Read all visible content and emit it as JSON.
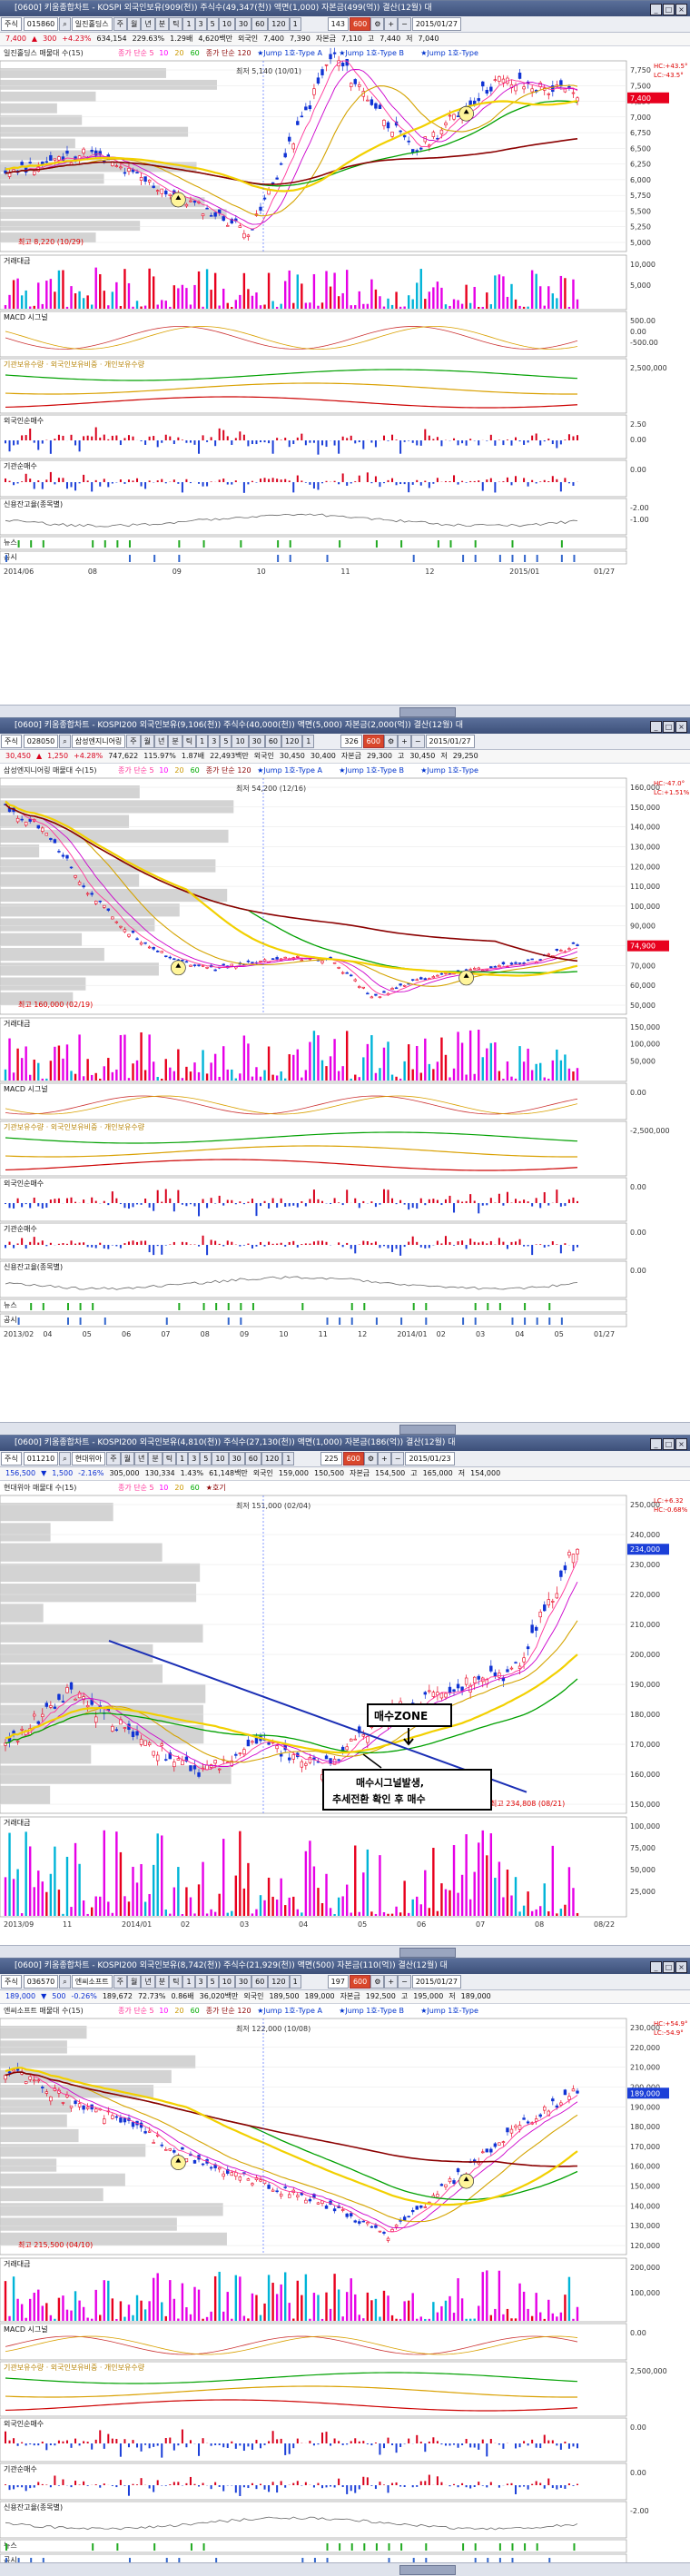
{
  "panels": [
    {
      "id": "p1",
      "title": "[0600] 키움종합차트 - KOSPI 외국인보유(909(천)) 주식수(49,347(천)) 액면(1,000) 자본금(499(억)) 결산(12월) 대",
      "code": "015860",
      "name": "일진홀딩스",
      "period_buttons": [
        "주",
        "월",
        "년",
        "분",
        "틱",
        "1",
        "3",
        "5",
        "10",
        "30",
        "60",
        "120",
        "1"
      ],
      "count": "143",
      "count2": "600",
      "date": "2015/01/27",
      "quote": [
        "7,400",
        "▲",
        "300",
        "+4.23%",
        "634,154",
        "229.63%",
        "1.29배",
        "4,620백만",
        "외국인",
        "7,400",
        "7,390",
        "자본금",
        "7,110",
        "고",
        "7,440",
        "저",
        "7,040"
      ],
      "legend_head": "일진홀딩스 매물대 수(15)",
      "legend_items": [
        "종가 단순 5",
        "10",
        "20",
        "60",
        "종가 단순 120",
        "★Jump 1호-Type A",
        "★Jump 1호-Type B",
        "★Jump 1호-Type"
      ],
      "axis_right": [
        "7,750",
        "7,500",
        "7,250",
        "7,000",
        "6,750",
        "6,500",
        "6,250",
        "6,000",
        "5,750",
        "5,500",
        "5,250",
        "5,000"
      ],
      "ann_high": "최저 5,140 (10/01)",
      "ann_low": "최고 8,220 (10/29)",
      "price_label": "7,400",
      "side_labels": [
        "HC:+43.5°",
        "LC:-43.5°"
      ],
      "sub": [
        {
          "label": "거래대금",
          "axis": [
            "10,000",
            "5,000"
          ]
        },
        {
          "label": "MACD 시그널",
          "axis": [
            "500.00",
            "0.00",
            "-500.00"
          ]
        },
        {
          "label": "기관보유수량 · 외국인보유비중 · 개인보유수량",
          "axis": [
            "2,500,000"
          ]
        },
        {
          "label": "외국인순매수",
          "axis": [
            "2.50",
            "0.00"
          ]
        },
        {
          "label": "기관순매수",
          "axis": [
            "0.00"
          ]
        },
        {
          "label": "신용잔고율(종목별)",
          "axis": [
            "-2.00",
            "-1.00"
          ]
        },
        {
          "label": "뉴스",
          "axis": []
        },
        {
          "label": "공시",
          "axis": []
        }
      ],
      "x_labels": [
        "2014/06",
        "08",
        "09",
        "10",
        "11",
        "12",
        "2015/01",
        "01/27"
      ]
    },
    {
      "id": "p2",
      "title": "[0600] 키움종합차트 - KOSPI200 외국인보유(9,106(천)) 주식수(40,000(천)) 액면(5,000) 자본금(2,000(억)) 결산(12월) 대",
      "code": "028050",
      "name": "삼성엔지니어링",
      "period_buttons": [
        "주",
        "월",
        "년",
        "분",
        "틱",
        "1",
        "3",
        "5",
        "10",
        "30",
        "60",
        "120",
        "1"
      ],
      "count": "326",
      "count2": "600",
      "date": "2015/01/27",
      "quote": [
        "30,450",
        "▲",
        "1,250",
        "+4.28%",
        "747,622",
        "115.97%",
        "1.87배",
        "22,493백만",
        "외국인",
        "30,450",
        "30,400",
        "자본금",
        "29,300",
        "고",
        "30,450",
        "저",
        "29,250"
      ],
      "legend_head": "삼성엔지니어링 매물대 수(15)",
      "legend_items": [
        "종가 단순 5",
        "10",
        "20",
        "60",
        "종가 단순 120",
        "★Jump 1호-Type A",
        "★Jump 1호-Type B",
        "★Jump 1호-Type"
      ],
      "axis_right": [
        "160,000",
        "150,000",
        "140,000",
        "130,000",
        "120,000",
        "110,000",
        "100,000",
        "90,000",
        "80,000",
        "70,000",
        "60,000",
        "50,000"
      ],
      "ann_high": "최저 54,200 (12/16)",
      "ann_low": "최고 160,000 (02/19)",
      "price_label": "74,900",
      "side_labels": [
        "HC:-47.0°",
        "LC:+1.51%"
      ],
      "sub": [
        {
          "label": "거래대금",
          "axis": [
            "150,000",
            "100,000",
            "50,000"
          ]
        },
        {
          "label": "MACD 시그널",
          "axis": [
            "0.00"
          ]
        },
        {
          "label": "기관보유수량 · 외국인보유비중 · 개인보유수량",
          "axis": [
            "-2,500,000"
          ]
        },
        {
          "label": "외국인순매수",
          "axis": [
            "0.00"
          ]
        },
        {
          "label": "기관순매수",
          "axis": [
            "0.00"
          ]
        },
        {
          "label": "신용잔고율(종목별)",
          "axis": [
            "0.00"
          ]
        },
        {
          "label": "뉴스",
          "axis": []
        },
        {
          "label": "공시",
          "axis": []
        }
      ],
      "x_labels": [
        "2013/02",
        "04",
        "05",
        "06",
        "07",
        "08",
        "09",
        "10",
        "11",
        "12",
        "2014/01",
        "02",
        "03",
        "04",
        "05",
        "01/27"
      ]
    },
    {
      "id": "p3",
      "title": "[0600] 키움종합차트 - KOSPI200 외국인보유(4,810(천)) 주식수(27,130(천)) 액면(1,000) 자본금(186(억)) 결산(12월) 대",
      "code": "011210",
      "name": "현대위아",
      "period_buttons": [
        "주",
        "월",
        "년",
        "분",
        "틱",
        "1",
        "3",
        "5",
        "10",
        "30",
        "60",
        "120",
        "1"
      ],
      "count": "225",
      "count2": "600",
      "date": "2015/01/23",
      "quote": [
        "156,500",
        "▼",
        "1,500",
        "-2.16%",
        "305,000",
        "130,334",
        "1.43%",
        "61,148백만",
        "외국인",
        "159,000",
        "150,500",
        "자본금",
        "154,500",
        "고",
        "165,000",
        "저",
        "154,000"
      ],
      "legend_head": "현대위아 매물대 수(15)",
      "legend_items": [
        "종가 단순 5",
        "10",
        "20",
        "60",
        "★호기"
      ],
      "axis_right": [
        "250,000",
        "240,000",
        "230,000",
        "220,000",
        "210,000",
        "200,000",
        "190,000",
        "180,000",
        "170,000",
        "160,000",
        "150,000"
      ],
      "ann_high": "최저 151,000 (02/04)",
      "ann_low": "최고 234,808 (08/21)",
      "price_label": "234,000",
      "side_labels": [
        "LC:+6.32",
        "HC:-0.68%"
      ],
      "callout_top": "매수ZONE",
      "callout_bottom_1": "매수시그널발생,",
      "callout_bottom_2": "추세전환 확인 후 매수",
      "sub": [
        {
          "label": "거래대금",
          "axis": [
            "100,000",
            "75,000",
            "50,000",
            "25,000"
          ]
        }
      ],
      "x_labels": [
        "2013/09",
        "11",
        "2014/01",
        "02",
        "03",
        "04",
        "05",
        "06",
        "07",
        "08",
        "08/22"
      ]
    },
    {
      "id": "p4",
      "title": "[0600] 키움종합차트 - KOSPI200 외국인보유(8,742(천)) 주식수(21,929(천)) 액면(500) 자본금(110(억)) 결산(12월) 대",
      "code": "036570",
      "name": "엔씨소프트",
      "period_buttons": [
        "주",
        "월",
        "년",
        "분",
        "틱",
        "1",
        "3",
        "5",
        "10",
        "30",
        "60",
        "120",
        "1"
      ],
      "count": "197",
      "count2": "600",
      "date": "2015/01/27",
      "quote": [
        "189,000",
        "▼",
        "500",
        "-0.26%",
        "189,672",
        "72.73%",
        "0.86배",
        "36,020백만",
        "외국인",
        "189,500",
        "189,000",
        "자본금",
        "192,500",
        "고",
        "195,000",
        "저",
        "189,000"
      ],
      "legend_head": "엔씨소프트 매물대 수(15)",
      "legend_items": [
        "종가 단순 5",
        "10",
        "20",
        "60",
        "종가 단순 120",
        "★Jump 1호-Type A",
        "★Jump 1호-Type B",
        "★Jump 1호-Type"
      ],
      "axis_right": [
        "230,000",
        "220,000",
        "210,000",
        "200,000",
        "190,000",
        "180,000",
        "170,000",
        "160,000",
        "150,000",
        "140,000",
        "130,000",
        "120,000"
      ],
      "ann_high": "최저 122,000 (10/08)",
      "ann_low": "최고 215,500 (04/10)",
      "price_label": "189,000",
      "side_labels": [
        "HC:+54.9°",
        "LC:-54.9°"
      ],
      "sub": [
        {
          "label": "거래대금",
          "axis": [
            "200,000",
            "100,000"
          ]
        },
        {
          "label": "MACD 시그널",
          "axis": [
            "0.00"
          ]
        },
        {
          "label": "기관보유수량 · 외국인보유비중 · 개인보유수량",
          "axis": [
            "2,500,000"
          ]
        },
        {
          "label": "외국인순매수",
          "axis": [
            "0.00"
          ]
        },
        {
          "label": "기관순매수",
          "axis": [
            "0.00"
          ]
        },
        {
          "label": "신용잔고율(종목별)",
          "axis": [
            "-2.00"
          ]
        },
        {
          "label": "뉴스",
          "axis": []
        },
        {
          "label": "공시",
          "axis": []
        }
      ],
      "x_labels": [
        "2014/04",
        "05",
        "06",
        "07",
        "08",
        "09",
        "10",
        "11",
        "12",
        "2015/01",
        "01/27"
      ]
    }
  ],
  "chart_data": [
    {
      "type": "line",
      "panel": "p1",
      "x": [
        "2014/06",
        "08",
        "09",
        "10",
        "11",
        "12",
        "2015/01",
        "01/27"
      ],
      "series": [
        {
          "values": [
            6200,
            6500,
            5900,
            5300,
            8000,
            6500,
            7600,
            7400
          ]
        }
      ],
      "ylim": [
        5000,
        7900
      ]
    },
    {
      "type": "line",
      "panel": "p2",
      "x": [
        "2013/02",
        "04",
        "05",
        "06",
        "07",
        "08",
        "09",
        "10",
        "11",
        "12",
        "2014/01",
        "02",
        "03",
        "04",
        "05"
      ],
      "series": [
        {
          "values": [
            150000,
            140000,
            110000,
            90000,
            78000,
            72000,
            75000,
            78000,
            76000,
            58000,
            66000,
            70000,
            73000,
            76000,
            84000
          ]
        }
      ],
      "ylim": [
        50000,
        165000
      ]
    },
    {
      "type": "line",
      "panel": "p3",
      "x": [
        "2013/09",
        "11",
        "2014/01",
        "02",
        "03",
        "04",
        "05",
        "06",
        "07",
        "08"
      ],
      "series": [
        {
          "values": [
            168000,
            185000,
            172000,
            158000,
            168000,
            160000,
            178000,
            186000,
            192000,
            234000
          ]
        }
      ],
      "ylim": [
        145000,
        250000
      ]
    },
    {
      "type": "line",
      "panel": "p4",
      "x": [
        "2014/04",
        "05",
        "06",
        "07",
        "08",
        "09",
        "10",
        "11",
        "12",
        "2015/01"
      ],
      "series": [
        {
          "values": [
            205000,
            190000,
            178000,
            160000,
            150000,
            140000,
            124000,
            150000,
            175000,
            195000
          ]
        }
      ],
      "ylim": [
        115000,
        230000
      ]
    }
  ]
}
